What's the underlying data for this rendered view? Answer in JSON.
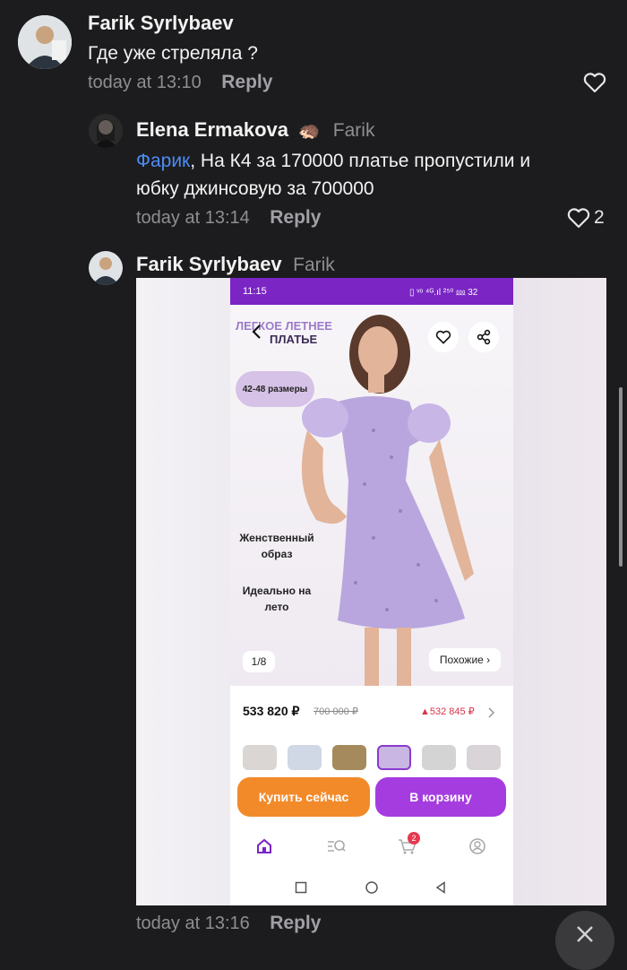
{
  "comments": [
    {
      "author": "Farik Syrlybaev",
      "text": "Где уже стреляла ?",
      "time": "today at 13:10",
      "reply_label": "Reply",
      "likes": ""
    },
    {
      "author": "Elena Ermakova",
      "author_emoji": "🦔",
      "reply_to": "Farik",
      "mention": "Фарик",
      "text_line1": ", На К4 за 170000 платье пропустили и",
      "text_line2": "юбку джинсовую за 700000",
      "time": "today at 13:14",
      "reply_label": "Reply",
      "likes": "2"
    },
    {
      "author": "Farik Syrlybaev",
      "reply_to": "Farik",
      "time": "today at 13:16",
      "reply_label": "Reply"
    }
  ],
  "screenshot": {
    "status_time": "11:15",
    "status_icons": "▯ ᵛᵒ ⁴ᴳ.ıl ²⁵⁰ ⅏ 32",
    "banner_line1": "ЛЕГКОЕ ЛЕТНЕЕ",
    "banner_line2": "ПЛАТЬЕ",
    "sizes_badge": "42-48 размеры",
    "feature1_line1": "Женственный",
    "feature1_line2": "образ",
    "feature2_line1": "Идеально на",
    "feature2_line2": "лето",
    "pager": "1/8",
    "similar_label": "Похожие ›",
    "price": "533 820 ₽",
    "old_price": "700 000 ₽",
    "alt_price": "▲532 845 ₽",
    "cart_badge": "2",
    "buy_now_label": "Купить сейчас",
    "to_cart_label": "В корзину"
  },
  "colors": {
    "background": "#1c1c1e",
    "mention": "#4c8cf6",
    "brand_purple": "#7a25c4",
    "buy_orange": "#f28a2a",
    "cart_purple": "#a53ce0",
    "dress_lilac": "#b9a6de",
    "alt_price_red": "#d8344a"
  },
  "icons": [
    "heart-icon",
    "back-arrow-icon",
    "share-icon",
    "home-icon",
    "catalog-search-icon",
    "cart-icon",
    "profile-icon",
    "chevron-right-icon",
    "close-chevron-icon"
  ]
}
